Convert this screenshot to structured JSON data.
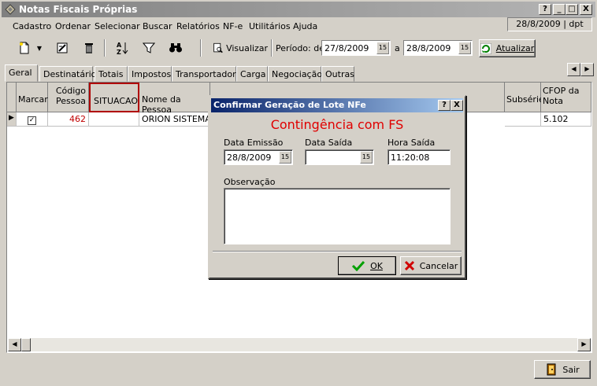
{
  "window": {
    "title": "Notas Fiscais Próprias",
    "caption_buttons": [
      "?",
      "_",
      "□",
      "X"
    ],
    "status_date": "28/8/2009 | dpt"
  },
  "menu": [
    "Cadastro",
    "Ordenar",
    "Selecionar",
    "Buscar",
    "Relatórios",
    "NF-e",
    "Utilitários",
    "Ajuda"
  ],
  "toolbar": {
    "visualizar_label": "Visualizar",
    "periodo_label": "Período: de",
    "date_from": "27/8/2009",
    "a_label": "a",
    "date_to": "28/8/2009",
    "atualizar_label": "Atualizar",
    "cal_glyph": "15"
  },
  "tabs": [
    "Geral",
    "Destinatário",
    "Totais",
    "Impostos",
    "Transportador",
    "Carga",
    "Negociação",
    "Outras"
  ],
  "table": {
    "headers": {
      "marcar": "Marcar",
      "codigo_1": "Código",
      "codigo_2": "Pessoa",
      "situacao": "SITUACAO",
      "nome": "Nome da Pessoa",
      "subserie": "Subsérie",
      "cfop_1": "CFOP da",
      "cfop_2": "Nota"
    },
    "rows": [
      {
        "marcar": "✓",
        "codigo": "462",
        "situacao": "",
        "nome": "ORION SISTEMAS",
        "subserie": "",
        "cfop": "5.102"
      }
    ]
  },
  "footer": {
    "sair_label": "Sair"
  },
  "dialog": {
    "title": "Confirmar Geração de Lote NFe",
    "heading": "Contingência com FS",
    "data_emissao_label": "Data Emissão",
    "data_emissao_value": "28/8/2009",
    "data_saida_label": "Data Saída",
    "data_saida_value": "",
    "hora_saida_label": "Hora Saída",
    "hora_saida_value": "11:20:08",
    "observacao_label": "Observação",
    "ok_label": "OK",
    "cancelar_label": "Cancelar",
    "help_btn": "?",
    "close_btn": "X"
  },
  "colors": {
    "heading_red": "#e00000",
    "code_red": "#c00000",
    "dialog_title_blue": "#0a246a"
  }
}
